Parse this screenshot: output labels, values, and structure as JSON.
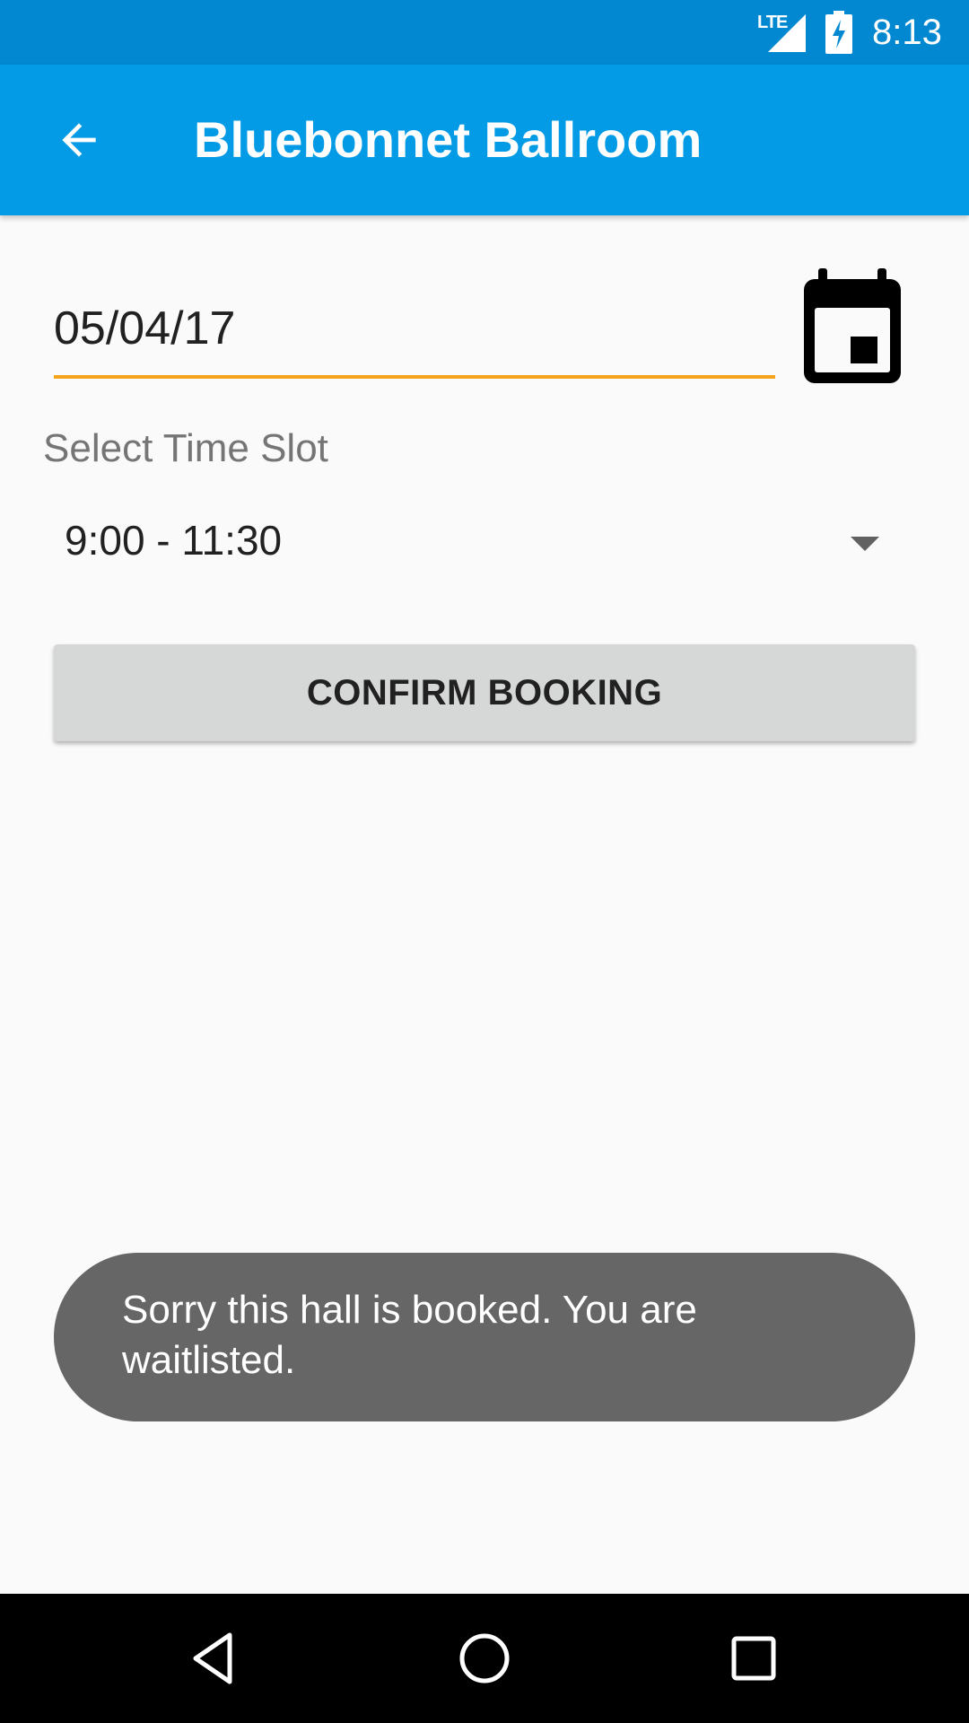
{
  "status_bar": {
    "network": "LTE",
    "time": "8:13",
    "icons": [
      "lte-signal-icon",
      "battery-charging-icon"
    ]
  },
  "app_bar": {
    "title": "Bluebonnet Ballroom",
    "back_icon": "arrow-back-icon",
    "background_color": "#039be5"
  },
  "form": {
    "date_value": "05/04/17",
    "date_underline_color": "#f5a31a",
    "calendar_icon": "calendar-icon",
    "timeslot_label": "Select Time Slot",
    "timeslot_selected": "9:00 - 11:30",
    "confirm_label": "CONFIRM BOOKING"
  },
  "toast": {
    "message": "Sorry this hall is booked. You are waitlisted."
  },
  "nav_bar": {
    "icons": [
      "nav-back-icon",
      "nav-home-icon",
      "nav-recents-icon"
    ]
  }
}
